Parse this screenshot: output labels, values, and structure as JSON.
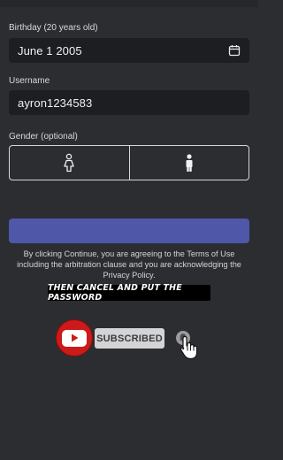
{
  "birthday": {
    "label": "Birthday (20 years old)",
    "value": "June 1 2005",
    "icon": "calendar-icon"
  },
  "username": {
    "label": "Username",
    "value": "ayron1234583"
  },
  "gender": {
    "label": "Gender (optional)",
    "options": [
      {
        "icon": "female-icon"
      },
      {
        "icon": "male-icon"
      }
    ]
  },
  "continue_button": {
    "color": "#4e57a8"
  },
  "terms_text": "By clicking Continue, you are agreeing to the Terms of Use including the arbitration clause and you are acknowledging the Privacy Policy.",
  "overlay": {
    "banner_text": "THEN CANCEL AND PUT THE PASSWORD",
    "subscribe_label": "SUBSCRIBED",
    "youtube_color": "#cc1a1a",
    "icons": [
      "youtube-icon",
      "bell-icon",
      "hand-cursor-icon"
    ]
  }
}
